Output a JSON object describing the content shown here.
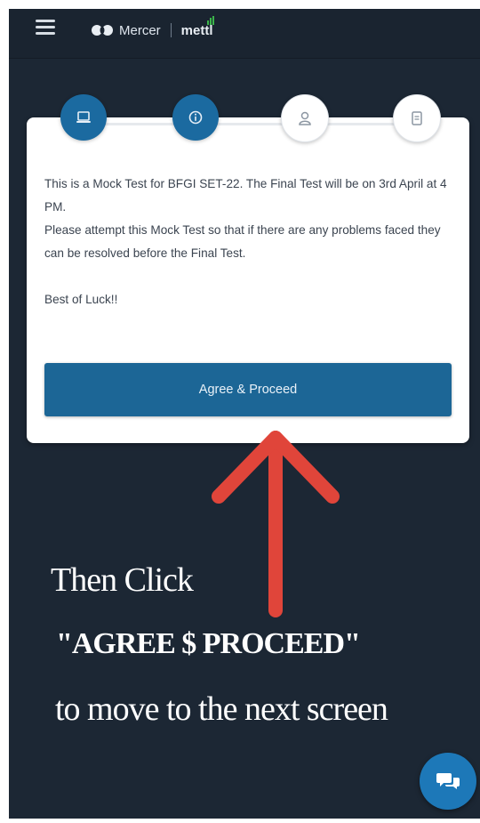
{
  "header": {
    "brand_name": "Mercer",
    "brand_sub": "mettl",
    "menu_icon": "hamburger-menu-icon"
  },
  "steps": [
    {
      "icon": "laptop-icon",
      "state": "completed"
    },
    {
      "icon": "info-icon",
      "state": "completed"
    },
    {
      "icon": "user-icon",
      "state": "pending"
    },
    {
      "icon": "document-icon",
      "state": "pending"
    }
  ],
  "card": {
    "message": "This is a Mock Test for BFGI SET-22. The Final Test will be on 3rd April at 4 PM.\nPlease attempt this Mock Test so that if there are any problems faced they can be resolved before the Final Test.\n\nBest of Luck!!",
    "button_label": "Agree & Proceed"
  },
  "instructions": {
    "line1": "Then Click",
    "line2": "\"AGREE $ PROCEED\"",
    "line3": "to  move to the next screen"
  },
  "chat": {
    "icon": "chat-icon"
  },
  "colors": {
    "background": "#1c2734",
    "accent": "#1c6696",
    "arrow": "#e0453a"
  }
}
